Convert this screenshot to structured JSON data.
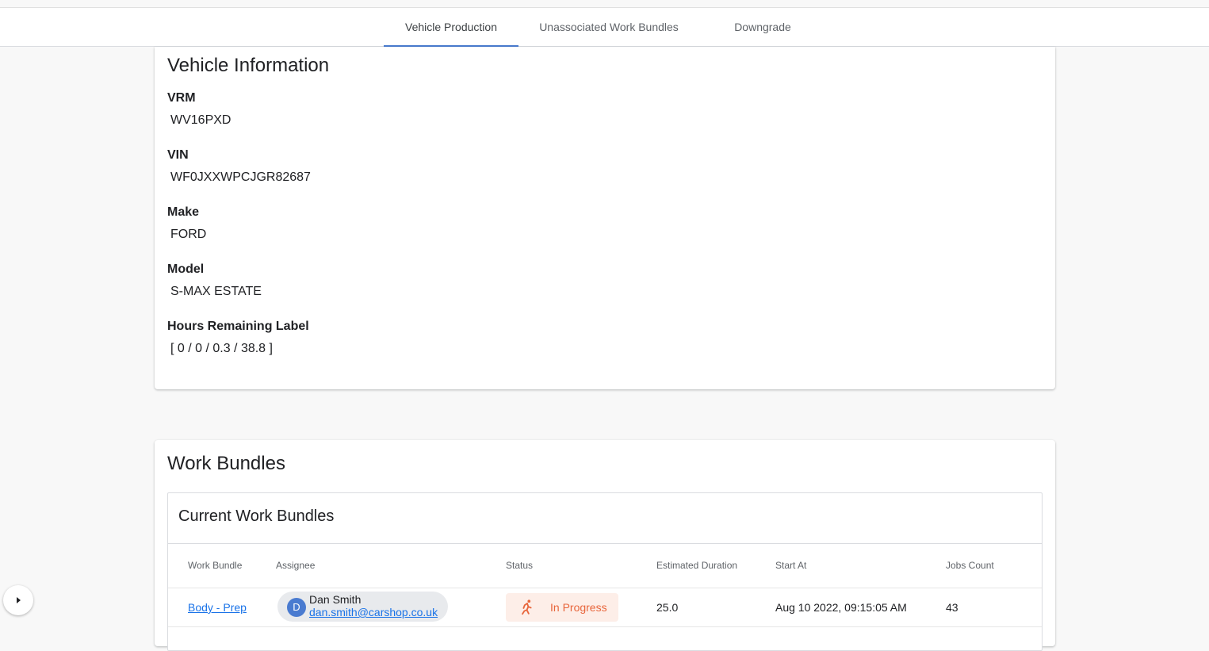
{
  "tabs": [
    {
      "label": "Vehicle Production",
      "active": true
    },
    {
      "label": "Unassociated Work Bundles",
      "active": false
    },
    {
      "label": "Downgrade",
      "active": false
    }
  ],
  "vehicle": {
    "title": "Vehicle Information",
    "fields": [
      {
        "label": "VRM",
        "value": "WV16PXD"
      },
      {
        "label": "VIN",
        "value": "WF0JXXWPCJGR82687"
      },
      {
        "label": "Make",
        "value": "FORD"
      },
      {
        "label": "Model",
        "value": "S-MAX ESTATE"
      },
      {
        "label": "Hours Remaining Label",
        "value": "[ 0 / 0 / 0.3 / 38.8 ]"
      }
    ]
  },
  "bundles": {
    "title": "Work Bundles",
    "panel_title": "Current Work Bundles",
    "columns": [
      "Work Bundle",
      "Assignee",
      "Status",
      "Estimated Duration",
      "Start At",
      "Jobs Count"
    ],
    "rows": [
      {
        "work_bundle": "Body - Prep",
        "assignee_initial": "D",
        "assignee_name": "Dan Smith",
        "assignee_email": "dan.smith@carshop.co.uk",
        "status": "In Progress",
        "estimated_duration": "25.0",
        "start_at": "Aug 10 2022, 09:15:05 AM",
        "jobs_count": "43"
      }
    ]
  },
  "colors": {
    "accent": "#4a7bd0",
    "link": "#1a73e8",
    "status_in_progress": "#e8663c",
    "status_bg": "#fdeee8"
  },
  "icons": {
    "status": "running-person-icon",
    "fab": "chevron-right-icon"
  }
}
